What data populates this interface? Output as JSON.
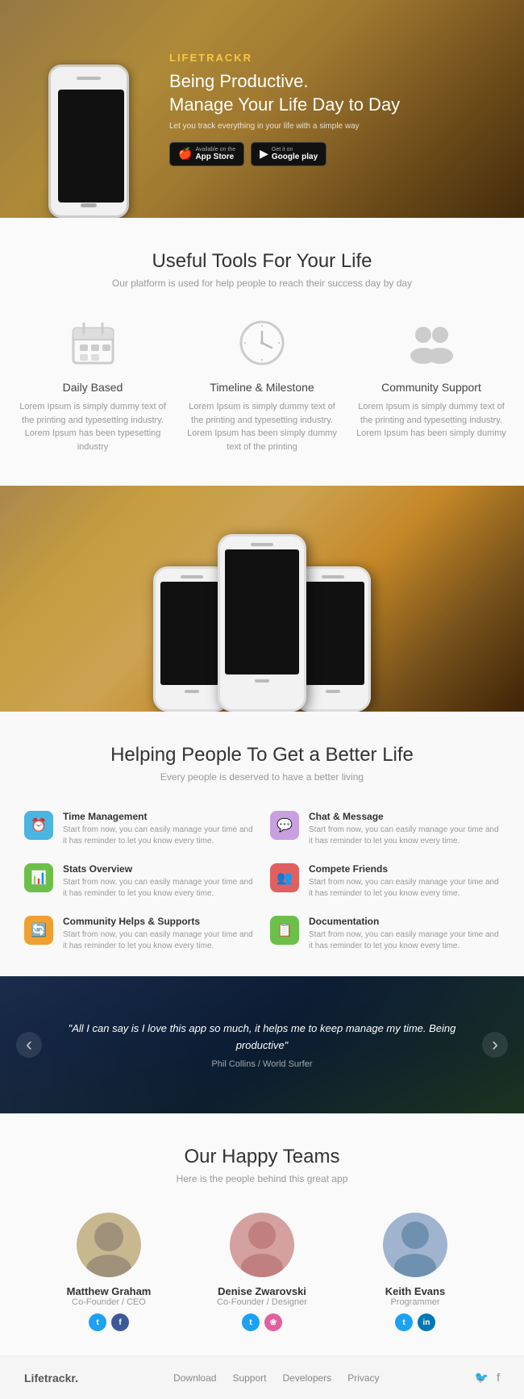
{
  "hero": {
    "logo": "LIFETRACKR",
    "title_line1": "Being Productive.",
    "title_line2": "Manage Your Life Day to Day",
    "subtitle": "Let you track everything in your life with a simple way",
    "appstore_small": "Available on the",
    "appstore_name": "App Store",
    "googleplay_small": "Get it on",
    "googleplay_name": "Google play"
  },
  "tools_section": {
    "title": "Useful Tools For Your Life",
    "subtitle": "Our platform is used for help people to reach their success day by day",
    "items": [
      {
        "name": "Daily Based",
        "desc": "Lorem Ipsum is simply dummy text of the printing and typesetting industry. Lorem Ipsum has been typesetting industry"
      },
      {
        "name": "Timeline & Milestone",
        "desc": "Lorem Ipsum is simply dummy text of the printing and typesetting industry. Lorem Ipsum has been simply dummy text of the printing"
      },
      {
        "name": "Community Support",
        "desc": "Lorem Ipsum is simply dummy text of the printing and typesetting industry. Lorem Ipsum has been simply dummy"
      }
    ]
  },
  "better_section": {
    "title": "Helping People To Get a Better Life",
    "subtitle": "Every people is deserved to have a better living",
    "features": [
      {
        "name": "Time Management",
        "desc": "Start from now, you can easily manage your time and it has reminder to let you know every time.",
        "color": "#4ab5e0",
        "icon": "⏰"
      },
      {
        "name": "Stats Overview",
        "desc": "Start from now, you can easily manage your time and it has reminder to let you know every time.",
        "color": "#6cc04a",
        "icon": "📊"
      },
      {
        "name": "Community Helps & Supports",
        "desc": "Start from now, you can easily manage your time and it has reminder to let you know every time.",
        "color": "#f0a030",
        "icon": "🔄"
      },
      {
        "name": "Chat & Message",
        "desc": "Start from now, you can easily manage your time and it has reminder to let you know every time.",
        "color": "#c8a0e0",
        "icon": "💬"
      },
      {
        "name": "Compete Friends",
        "desc": "Start from now, you can easily manage your time and it has reminder to let you know every time.",
        "color": "#e06060",
        "icon": "👥"
      },
      {
        "name": "Documentation",
        "desc": "Start from now, you can easily manage your time and it has reminder to let you know every time.",
        "color": "#6cc04a",
        "icon": "📋"
      }
    ]
  },
  "testimonial": {
    "quote_start": "\"All I can say is I love this app so much, it helps me to keep manage my time. Being productive\"",
    "author": "Phil Collins / World Surfer"
  },
  "team_section": {
    "title": "Our Happy Teams",
    "subtitle": "Here is the people behind this great app",
    "members": [
      {
        "name": "Matthew Graham",
        "role": "Co-Founder / CEO",
        "avatar_char": "👴",
        "bg": "#c8b090",
        "socials": [
          {
            "icon": "t",
            "color": "#1da1f2"
          },
          {
            "icon": "f",
            "color": "#3b5998"
          }
        ]
      },
      {
        "name": "Denise Zwarovski",
        "role": "Co-Founder / Designer",
        "avatar_char": "👩",
        "bg": "#d4a0a0",
        "socials": [
          {
            "icon": "t",
            "color": "#1da1f2"
          },
          {
            "icon": "❀",
            "color": "#e060a0"
          }
        ]
      },
      {
        "name": "Keith Evans",
        "role": "Programmer",
        "avatar_char": "👨",
        "bg": "#a0b4d0",
        "socials": [
          {
            "icon": "t",
            "color": "#1da1f2"
          },
          {
            "icon": "in",
            "color": "#0077b5"
          }
        ]
      }
    ]
  },
  "footer": {
    "logo": "Lifetrackr.",
    "nav": [
      "Download",
      "Support",
      "Developers",
      "Privacy"
    ],
    "social_icons": [
      "twitter",
      "facebook"
    ]
  }
}
